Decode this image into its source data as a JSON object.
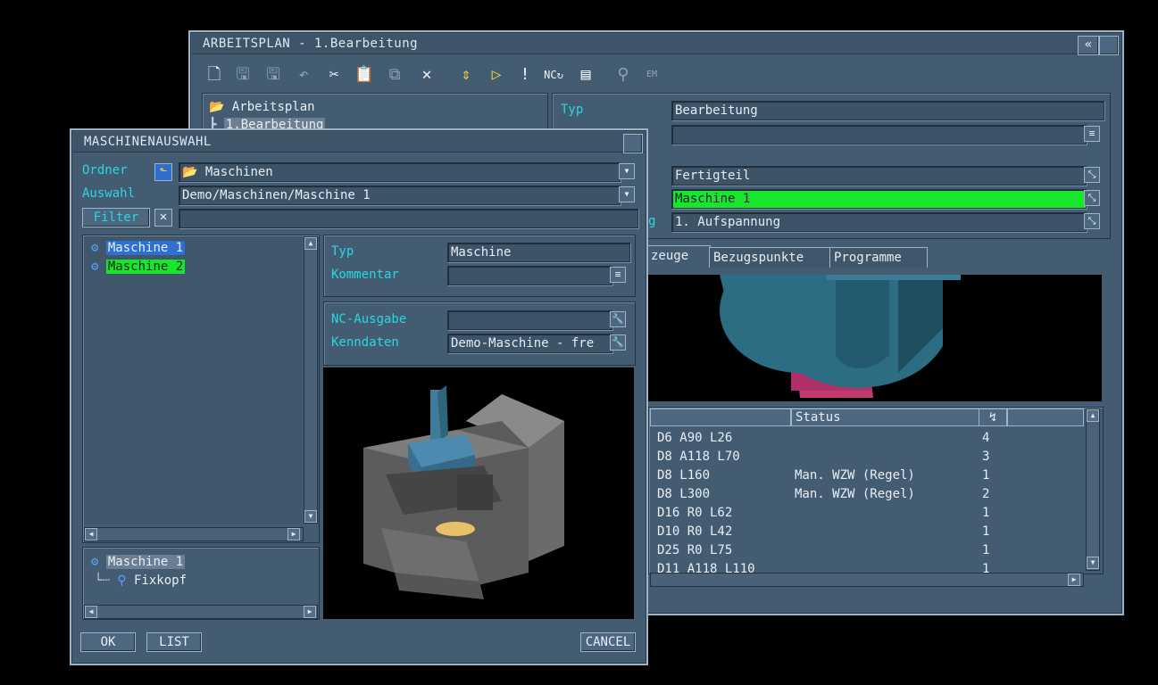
{
  "main_window": {
    "title": "ARBEITSPLAN - 1.Bearbeitung",
    "collapse_glyph": "«",
    "tree": {
      "root": "Arbeitsplan",
      "child": "1.Bearbeitung"
    },
    "fields": {
      "typ_label": "Typ",
      "typ_value": "Bearbeitung",
      "fertigteil": "Fertigteil",
      "maschine": "Maschine 1",
      "aufspannung_label_fragment": "g",
      "aufspannung": "1. Aufspannung"
    },
    "tabs": [
      "zeuge",
      "Bezugspunkte",
      "Programme"
    ],
    "table": {
      "status_header": "Status",
      "sort_glyph": "↯",
      "rows": [
        {
          "tool": "D6 A90 L26",
          "status": "",
          "count": "4"
        },
        {
          "tool": "D8 A118 L70",
          "status": "",
          "count": "3"
        },
        {
          "tool": "D8 L160",
          "status": "Man. WZW (Regel)",
          "count": "1"
        },
        {
          "tool": "D8 L300",
          "status": "Man. WZW (Regel)",
          "count": "2"
        },
        {
          "tool": "D16 R0 L62",
          "status": "",
          "count": "1"
        },
        {
          "tool": "D10 R0 L42",
          "status": "",
          "count": "1"
        },
        {
          "tool": "D25 R0 L75",
          "status": "",
          "count": "1"
        },
        {
          "tool": "D11 A118 L110",
          "status": "",
          "count": "1"
        }
      ]
    }
  },
  "dialog": {
    "title": "MASCHINENAUSWAHL",
    "ordner_label": "Ordner",
    "ordner_value": "Maschinen",
    "auswahl_label": "Auswahl",
    "auswahl_value": "Demo/Maschinen/Maschine 1",
    "filter_label": "Filter",
    "filter_value": "",
    "list_items": [
      "Maschine 1",
      "Maschine 2"
    ],
    "detail": {
      "typ_label": "Typ",
      "typ_value": "Maschine",
      "kommentar_label": "Kommentar",
      "kommentar_value": "",
      "nc_label": "NC-Ausgabe",
      "nc_value": "",
      "kenndaten_label": "Kenndaten",
      "kenndaten_value": "Demo-Maschine - fre"
    },
    "sub_tree": {
      "root": "Maschine 1",
      "child": "Fixkopf"
    },
    "buttons": {
      "ok": "OK",
      "list": "LIST",
      "cancel": "CANCEL"
    }
  },
  "colors": {
    "bg": "#000000",
    "window": "#445c72",
    "label_cyan": "#2ad6e6",
    "highlight_green": "#17e62c",
    "highlight_blue": "#2e6fd0"
  }
}
